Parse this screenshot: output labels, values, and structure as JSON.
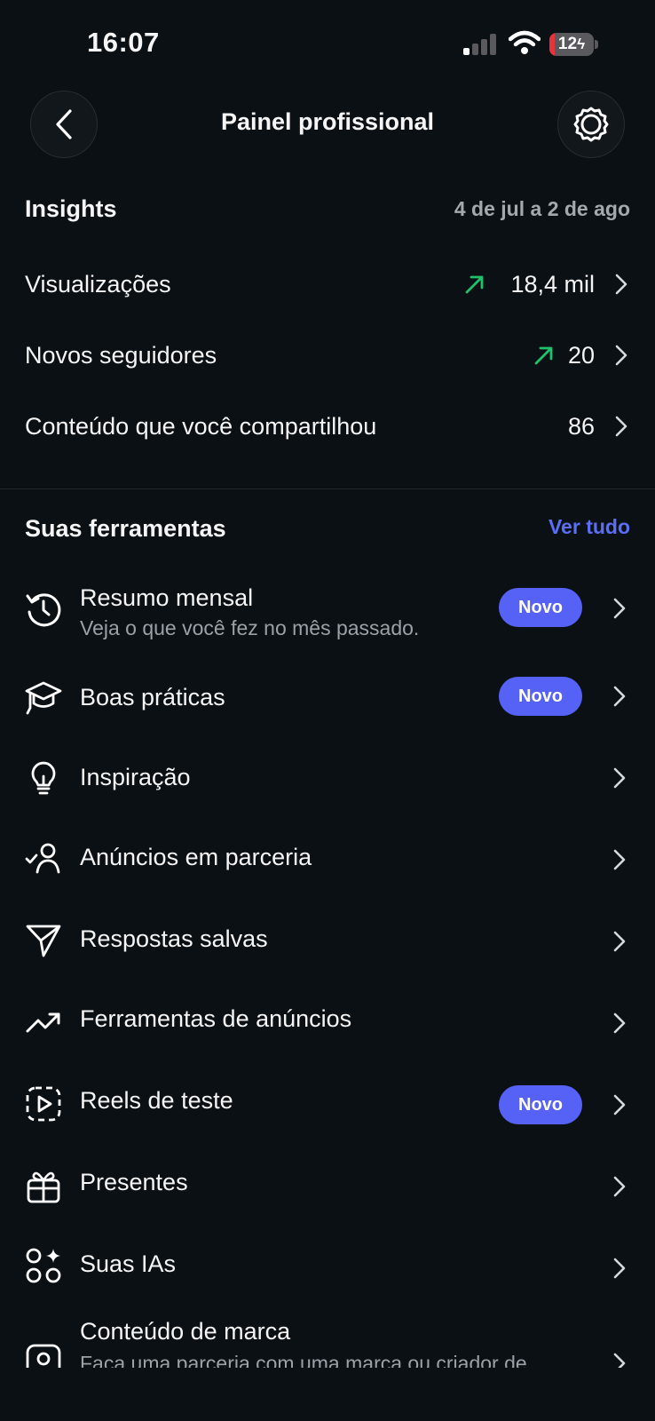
{
  "status": {
    "time": "16:07",
    "battery": "12",
    "battery_level": 0.12
  },
  "header": {
    "title": "Painel profissional",
    "back_icon": "chevron-left-icon",
    "settings_icon": "gear-icon"
  },
  "insights": {
    "title": "Insights",
    "date_range": "4 de jul a 2 de ago",
    "rows": [
      {
        "label": "Visualizações",
        "value": "18,4 mil",
        "trend": "up",
        "trend_color": "#1fc16b"
      },
      {
        "label": "Novos seguidores",
        "value": "20",
        "trend": "up",
        "trend_color": "#1fc16b"
      },
      {
        "label": "Conteúdo que você compartilhou",
        "value": "86"
      }
    ]
  },
  "tools": {
    "title": "Suas ferramentas",
    "see_all": "Ver tudo",
    "badge": "Novo",
    "items": [
      {
        "label": "Resumo mensal",
        "sub": "Veja o que você fez no mês passado.",
        "icon": "history-icon",
        "badge": true
      },
      {
        "label": "Boas práticas",
        "icon": "graduation-cap-icon",
        "badge": true
      },
      {
        "label": "Inspiração",
        "icon": "lightbulb-icon"
      },
      {
        "label": "Anúncios em parceria",
        "icon": "person-check-icon"
      },
      {
        "label": "Respostas salvas",
        "icon": "send-icon"
      },
      {
        "label": "Ferramentas de anúncios",
        "icon": "trend-up-icon"
      },
      {
        "label": "Reels de teste",
        "icon": "reels-test-icon",
        "badge": true
      },
      {
        "label": "Presentes",
        "icon": "gift-icon"
      },
      {
        "label": "Suas IAs",
        "icon": "ai-sparkle-icon"
      },
      {
        "label": "Conteúdo de marca",
        "sub": "Faça uma parceria com uma marca ou criador de",
        "icon": "branded-content-icon"
      }
    ]
  },
  "colors": {
    "background": "#0b1014",
    "accent": "#5662f6",
    "link": "#5b6ef5",
    "trend": "#1fc16b"
  }
}
